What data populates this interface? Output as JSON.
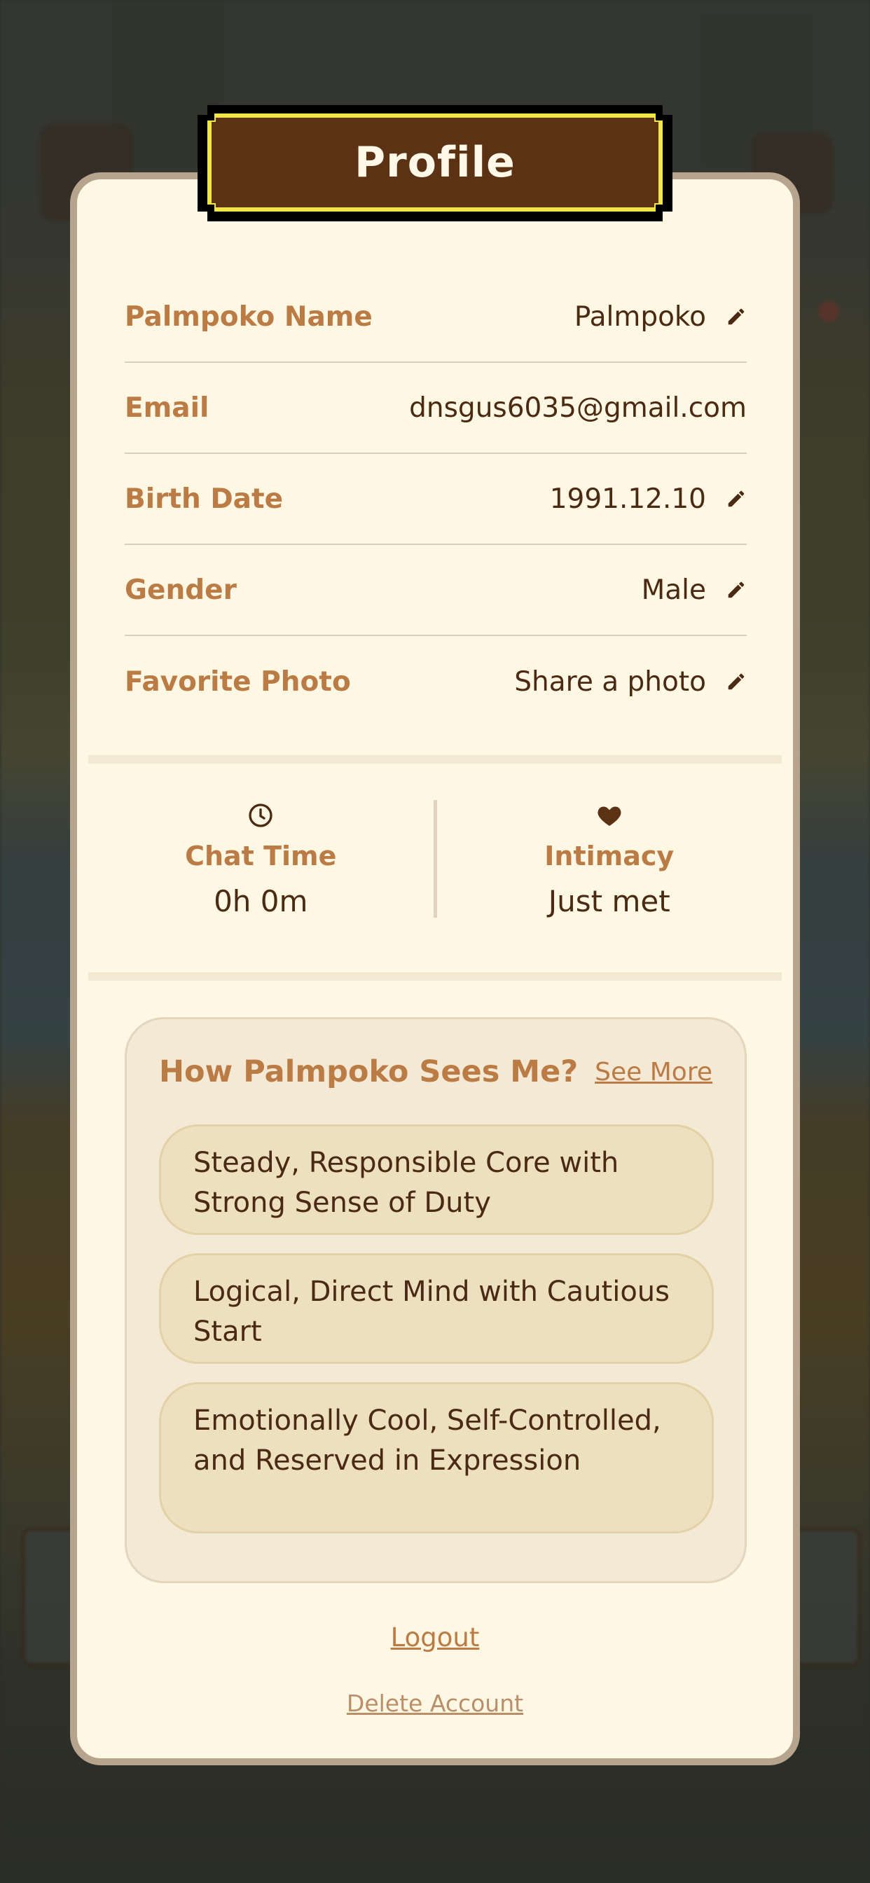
{
  "modal": {
    "title": "Profile"
  },
  "fields": [
    {
      "label": "Palmpoko Name",
      "value": "Palmpoko",
      "editable": true
    },
    {
      "label": "Email",
      "value": "dnsgus6035@gmail.com",
      "editable": false
    },
    {
      "label": "Birth Date",
      "value": "1991.12.10",
      "editable": true
    },
    {
      "label": "Gender",
      "value": "Male",
      "editable": true
    },
    {
      "label": "Favorite Photo",
      "value": "Share a photo",
      "editable": true
    }
  ],
  "stats": {
    "chat_time": {
      "icon": "clock-icon",
      "label": "Chat Time",
      "value": "0h 0m"
    },
    "intimacy": {
      "icon": "heart-icon",
      "label": "Intimacy",
      "value": "Just met"
    }
  },
  "insights": {
    "title": "How Palmpoko Sees Me?",
    "see_more": "See More",
    "traits": [
      "Steady, Responsible Core with Strong Sense of Duty",
      "Logical, Direct Mind with Cautious Start",
      "Emotionally Cool, Self-Controlled, and Reserved in Expression"
    ]
  },
  "footer": {
    "logout": "Logout",
    "delete_account": "Delete Account"
  },
  "colors": {
    "modal_bg": "#fef7e4",
    "accent": "#bb7b45",
    "text_dark": "#4a2a12",
    "title_plate": "#5b3314",
    "title_border": "#f2e44b"
  }
}
